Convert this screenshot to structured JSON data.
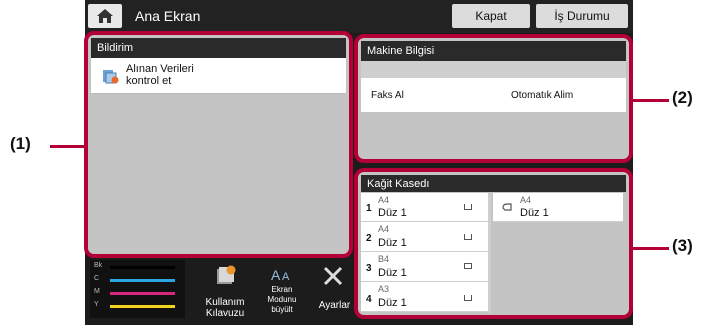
{
  "header": {
    "title": "Ana Ekran",
    "close_label": "Kapat",
    "job_status_label": "İş Durumu"
  },
  "notification": {
    "title": "Bildirim",
    "item_text_line1": "Alınan Verileri",
    "item_text_line2": "kontrol et"
  },
  "machine_info": {
    "title": "Makine Bilgisi",
    "fax_label": "Faks Al",
    "fax_value": "Otomatık Alim"
  },
  "paper_tray": {
    "title": "Kağit Kasedı",
    "trays": [
      {
        "num": "1",
        "size": "A4",
        "type": "Düz 1"
      },
      {
        "num": "2",
        "size": "A4",
        "type": "Düz 1"
      },
      {
        "num": "3",
        "size": "B4",
        "type": "Düz 1"
      },
      {
        "num": "4",
        "size": "A3",
        "type": "Düz 1"
      }
    ],
    "bypass": {
      "size": "A4",
      "type": "Düz 1"
    }
  },
  "toner": {
    "labels": [
      "Bk",
      "C",
      "M",
      "Y"
    ],
    "colors": [
      "#000000",
      "#2aa7e0",
      "#d8257e",
      "#f2d21b"
    ],
    "levels": [
      0.95,
      0.95,
      0.95,
      0.95
    ]
  },
  "bottom_bar": {
    "user_guide_line1": "Kullanım",
    "user_guide_line2": "Kılavuzu",
    "screen_mode_line1": "Ekran",
    "screen_mode_line2": "Modunu",
    "screen_mode_line3": "büyült",
    "settings_label": "Ayarlar"
  },
  "callouts": {
    "c1": "(1)",
    "c2": "(2)",
    "c3": "(3)"
  }
}
